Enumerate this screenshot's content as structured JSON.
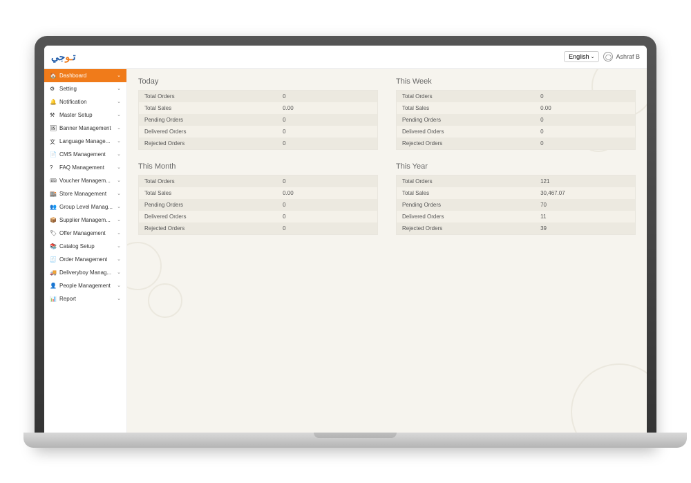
{
  "header": {
    "logo_text": "تـوجي",
    "lang_label": "English",
    "user_name": "Ashraf B"
  },
  "sidebar": {
    "items": [
      {
        "label": "Dashboard",
        "icon": "🏠",
        "active": true
      },
      {
        "label": "Setting",
        "icon": "⚙",
        "active": false
      },
      {
        "label": "Notification",
        "icon": "🔔",
        "active": false
      },
      {
        "label": "Master Setup",
        "icon": "⚒",
        "active": false
      },
      {
        "label": "Banner Management",
        "icon": "🖼",
        "active": false
      },
      {
        "label": "Language Manage...",
        "icon": "文",
        "active": false
      },
      {
        "label": "CMS Management",
        "icon": "📄",
        "active": false
      },
      {
        "label": "FAQ Management",
        "icon": "?",
        "active": false
      },
      {
        "label": "Voucher Managem...",
        "icon": "🎟",
        "active": false
      },
      {
        "label": "Store Management",
        "icon": "🏬",
        "active": false
      },
      {
        "label": "Group Level Manag...",
        "icon": "👥",
        "active": false
      },
      {
        "label": "Supplier Managem...",
        "icon": "📦",
        "active": false
      },
      {
        "label": "Offer Management",
        "icon": "🏷",
        "active": false
      },
      {
        "label": "Catalog Setup",
        "icon": "📚",
        "active": false
      },
      {
        "label": "Order Management",
        "icon": "🧾",
        "active": false
      },
      {
        "label": "Deliveryboy Manag...",
        "icon": "🚚",
        "active": false
      },
      {
        "label": "People Management",
        "icon": "👤",
        "active": false
      },
      {
        "label": "Report",
        "icon": "📊",
        "active": false
      }
    ]
  },
  "panels": [
    {
      "title": "Today",
      "rows": [
        {
          "label": "Total Orders",
          "value": "0"
        },
        {
          "label": "Total Sales",
          "value": "0.00"
        },
        {
          "label": "Pending Orders",
          "value": "0"
        },
        {
          "label": "Delivered Orders",
          "value": "0"
        },
        {
          "label": "Rejected Orders",
          "value": "0"
        }
      ]
    },
    {
      "title": "This Week",
      "rows": [
        {
          "label": "Total Orders",
          "value": "0"
        },
        {
          "label": "Total Sales",
          "value": "0.00"
        },
        {
          "label": "Pending Orders",
          "value": "0"
        },
        {
          "label": "Delivered Orders",
          "value": "0"
        },
        {
          "label": "Rejected Orders",
          "value": "0"
        }
      ]
    },
    {
      "title": "This Month",
      "rows": [
        {
          "label": "Total Orders",
          "value": "0"
        },
        {
          "label": "Total Sales",
          "value": "0.00"
        },
        {
          "label": "Pending Orders",
          "value": "0"
        },
        {
          "label": "Delivered Orders",
          "value": "0"
        },
        {
          "label": "Rejected Orders",
          "value": "0"
        }
      ]
    },
    {
      "title": "This Year",
      "rows": [
        {
          "label": "Total Orders",
          "value": "121"
        },
        {
          "label": "Total Sales",
          "value": "30,467.07"
        },
        {
          "label": "Pending Orders",
          "value": "70"
        },
        {
          "label": "Delivered Orders",
          "value": "11"
        },
        {
          "label": "Rejected Orders",
          "value": "39"
        }
      ]
    }
  ]
}
